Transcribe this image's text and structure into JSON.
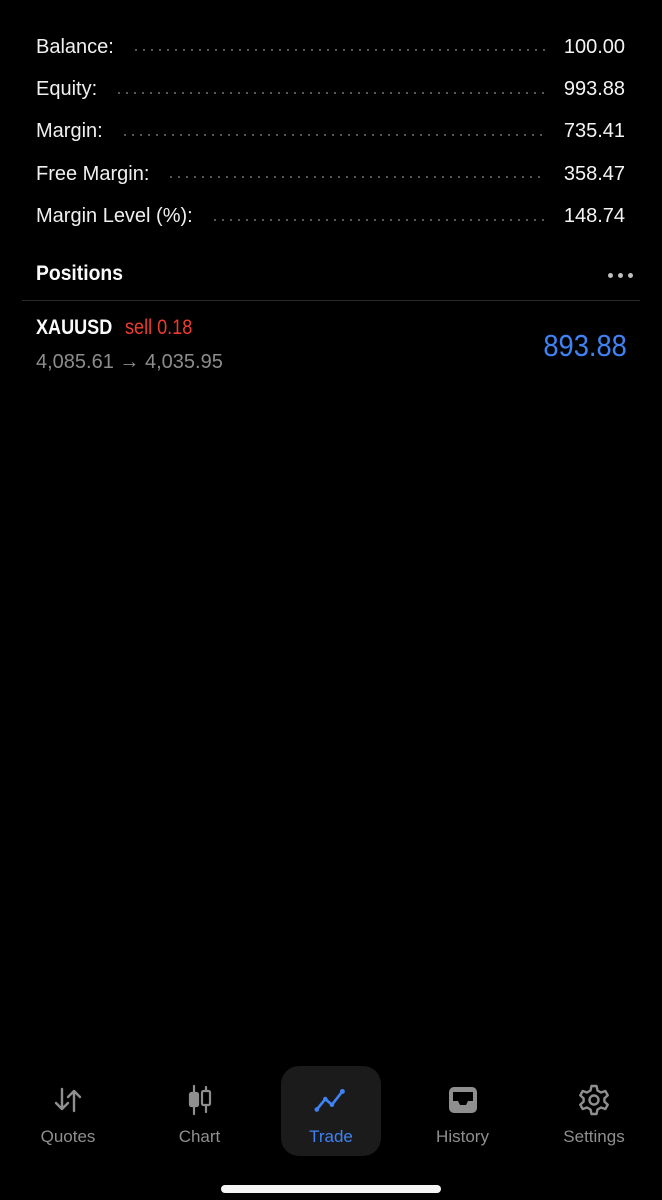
{
  "summary": [
    {
      "label": "Balance:",
      "value": "100.00"
    },
    {
      "label": "Equity:",
      "value": "993.88"
    },
    {
      "label": "Margin:",
      "value": "735.41"
    },
    {
      "label": "Free Margin:",
      "value": "358.47"
    },
    {
      "label": "Margin Level (%):",
      "value": "148.74"
    }
  ],
  "positions": {
    "title": "Positions",
    "items": [
      {
        "symbol": "XAUUSD",
        "side": "sell 0.18",
        "prices": "4,085.61 → 4,035.95",
        "profit": "893.88"
      }
    ]
  },
  "tabbar": {
    "tabs": [
      {
        "label": "Quotes",
        "icon": "quotes-arrows-icon"
      },
      {
        "label": "Chart",
        "icon": "candlestick-icon"
      },
      {
        "label": "Trade",
        "icon": "trend-line-icon",
        "active": true
      },
      {
        "label": "History",
        "icon": "inbox-tray-icon"
      },
      {
        "label": "Settings",
        "icon": "gear-icon"
      }
    ]
  },
  "colors": {
    "background": "#000000",
    "accent": "#3f82f3",
    "sell": "#ee3b31",
    "muted": "#8f8f8f"
  }
}
